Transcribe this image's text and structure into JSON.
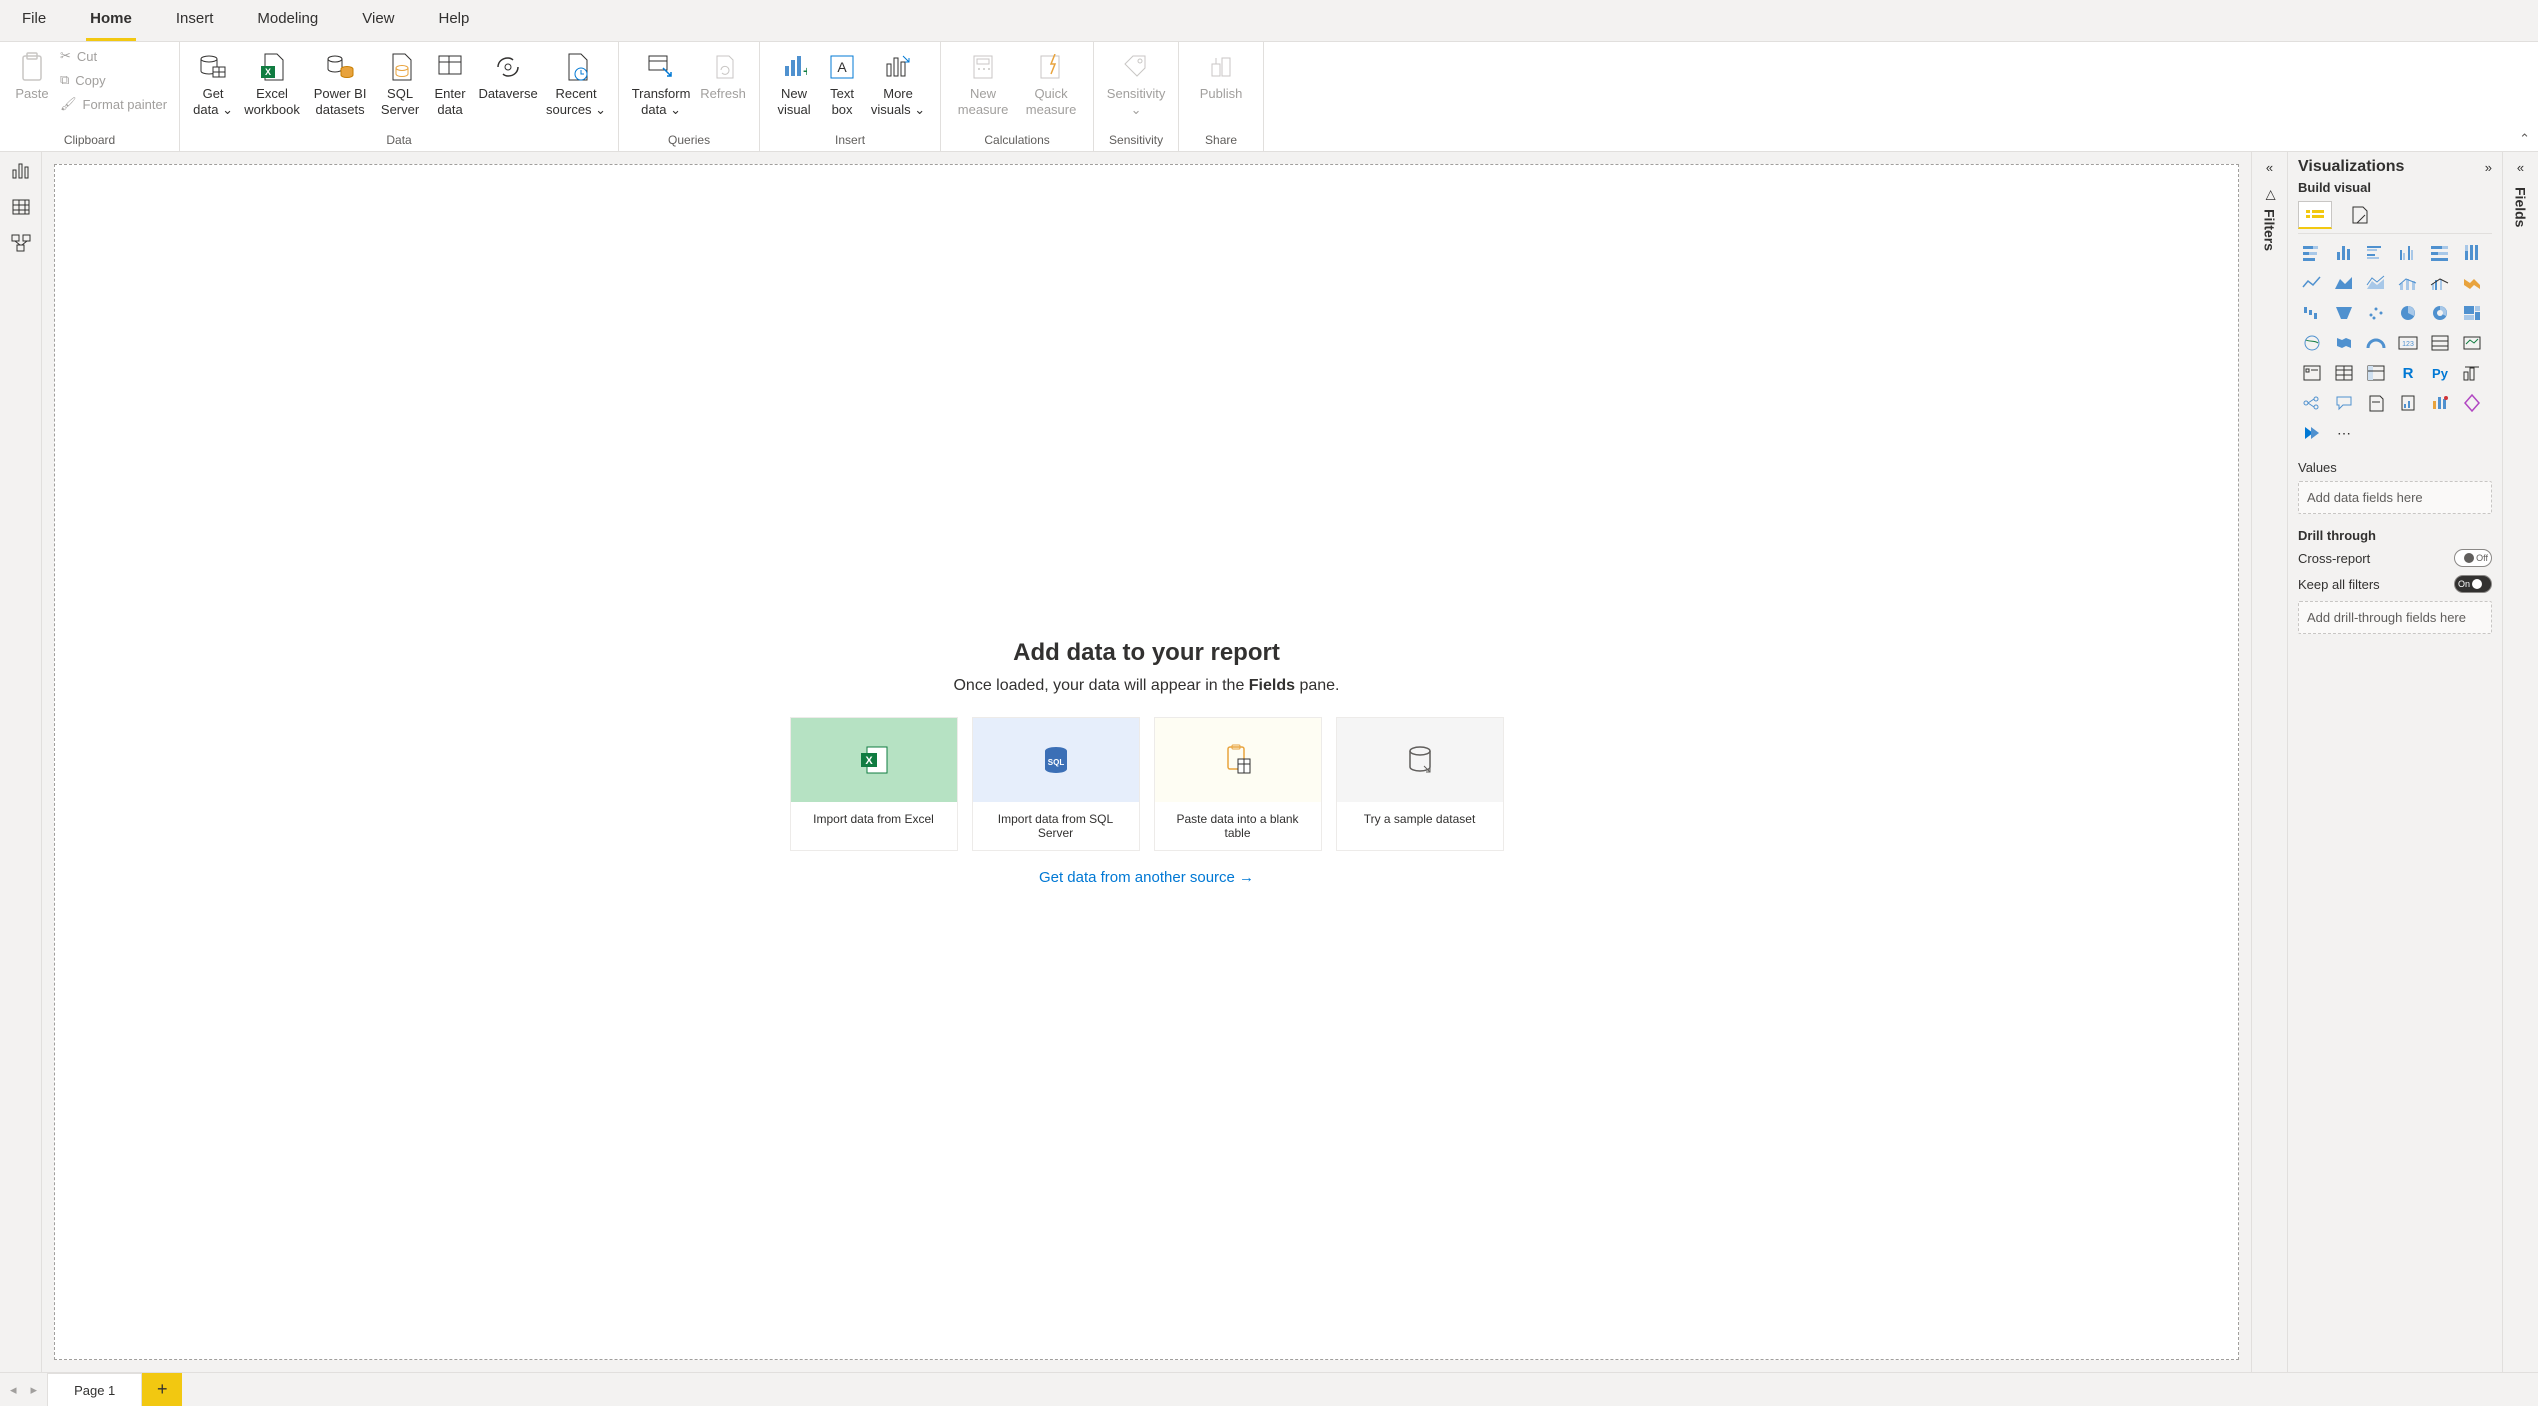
{
  "tabs": {
    "file": "File",
    "home": "Home",
    "insert": "Insert",
    "modeling": "Modeling",
    "view": "View",
    "help": "Help"
  },
  "ribbon": {
    "clipboard": {
      "label": "Clipboard",
      "paste": "Paste",
      "cut": "Cut",
      "copy": "Copy",
      "format": "Format painter"
    },
    "data": {
      "label": "Data",
      "get": "Get data",
      "excel": "Excel workbook",
      "pbi": "Power BI datasets",
      "sql": "SQL Server",
      "enter": "Enter data",
      "dataverse": "Dataverse",
      "recent": "Recent sources"
    },
    "queries": {
      "label": "Queries",
      "transform": "Transform data",
      "refresh": "Refresh"
    },
    "insert": {
      "label": "Insert",
      "visual": "New visual",
      "textbox": "Text box",
      "more": "More visuals"
    },
    "calc": {
      "label": "Calculations",
      "newm": "New measure",
      "quick": "Quick measure"
    },
    "sens": {
      "label": "Sensitivity",
      "btn": "Sensitivity"
    },
    "share": {
      "label": "Share",
      "publish": "Publish"
    }
  },
  "canvas": {
    "title": "Add data to your report",
    "subtitle_pre": "Once loaded, your data will appear in the ",
    "subtitle_bold": "Fields",
    "subtitle_post": " pane.",
    "cards": {
      "excel": "Import data from Excel",
      "sql": "Import data from SQL Server",
      "paste": "Paste data into a blank table",
      "sample": "Try a sample dataset"
    },
    "link": "Get data from another source →"
  },
  "panes": {
    "filters": "Filters",
    "viz": "Visualizations",
    "build": "Build visual",
    "fields": "Fields"
  },
  "viz_well": {
    "values": "Values",
    "values_placeholder": "Add data fields here",
    "drill": "Drill through",
    "cross": "Cross-report",
    "cross_state": "Off",
    "keep": "Keep all filters",
    "keep_state": "On",
    "drill_placeholder": "Add drill-through fields here"
  },
  "pages": {
    "p1": "Page 1"
  }
}
